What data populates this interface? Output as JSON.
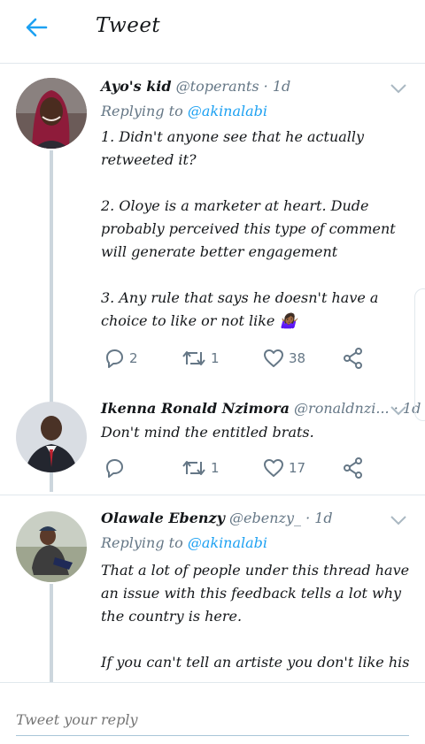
{
  "header": {
    "title": "Tweet",
    "back_icon": "arrow-left-icon",
    "accent": "#1da1f2"
  },
  "tweets": [
    {
      "name": "Ayo's kid",
      "handle": "@toperants",
      "time": "· 1d",
      "replying_label": "Replying to",
      "replying_to": "@akinalabi",
      "text": "1. Didn't anyone see that he actually retweeted it?\n\n2. Oloye is a marketer at heart. Dude probably perceived this type of comment will generate better engagement\n\n3. Any rule that says he doesn't have a choice to like or not like 🤷🏾‍♀️",
      "replies": "2",
      "retweets": "1",
      "likes": "38"
    },
    {
      "name": "Ikenna Ronald Nzimora",
      "handle": "@ronaldnzi...",
      "time": "· 1d",
      "text": "Don't mind the entitled brats.",
      "replies": "",
      "retweets": "1",
      "likes": "17"
    },
    {
      "name": "Olawale Ebenzy",
      "handle": "@ebenzy_",
      "time": "· 1d",
      "replying_label": "Replying to",
      "replying_to": "@akinalabi",
      "text": "That a lot of people under this thread have an issue with this feedback tells a lot why the country is here.\n\nIf you can't tell an artiste you don't like his"
    }
  ],
  "reply_bar": {
    "placeholder": "Tweet your reply"
  }
}
